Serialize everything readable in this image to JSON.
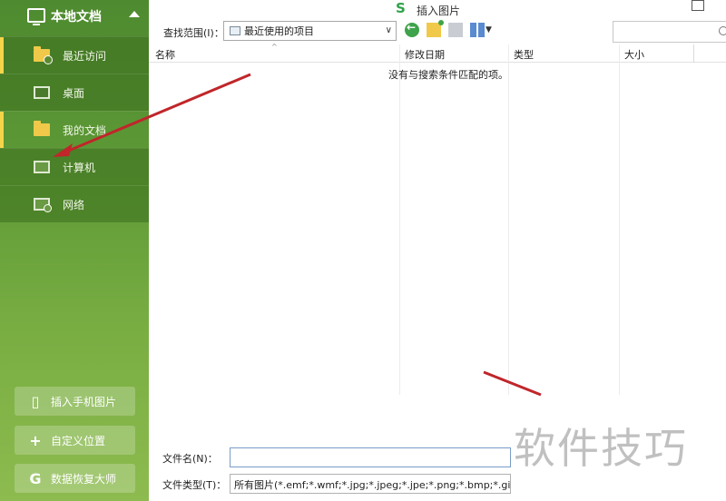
{
  "sidebar": {
    "title": "本地文档",
    "items": [
      {
        "label": "最近访问",
        "icon": "recent-folder-icon"
      },
      {
        "label": "桌面",
        "icon": "desktop-icon"
      },
      {
        "label": "我的文档",
        "icon": "folder-icon"
      },
      {
        "label": "计算机",
        "icon": "computer-icon"
      },
      {
        "label": "网络",
        "icon": "network-icon"
      }
    ],
    "buttons": [
      {
        "label": "插入手机图片",
        "icon": "phone-icon"
      },
      {
        "label": "自定义位置",
        "icon": "plus-icon"
      },
      {
        "label": "数据恢复大师",
        "icon": "recovery-icon"
      }
    ]
  },
  "dialog": {
    "title_logo": "S",
    "title": "插入图片"
  },
  "toolbar": {
    "look_in_label": "查找范围(I)：",
    "look_in_value": "最近使用的项目"
  },
  "list": {
    "columns": [
      "名称",
      "修改日期",
      "类型",
      "大小"
    ],
    "empty_message": "没有与搜索条件匹配的项。"
  },
  "bottom": {
    "filename_label": "文件名(N)：",
    "filename_value": "",
    "filetype_label": "文件类型(T)：",
    "filetype_value": "所有图片(*.emf;*.wmf;*.jpg;*.jpeg;*.jpe;*.png;*.bmp;*.gif;*.tif;*.tiff)"
  },
  "watermark": "软件技巧",
  "colors": {
    "sidebar_green": "#5e9a36",
    "active_marker": "#f4d54a",
    "arrow_red": "#c0262a"
  }
}
